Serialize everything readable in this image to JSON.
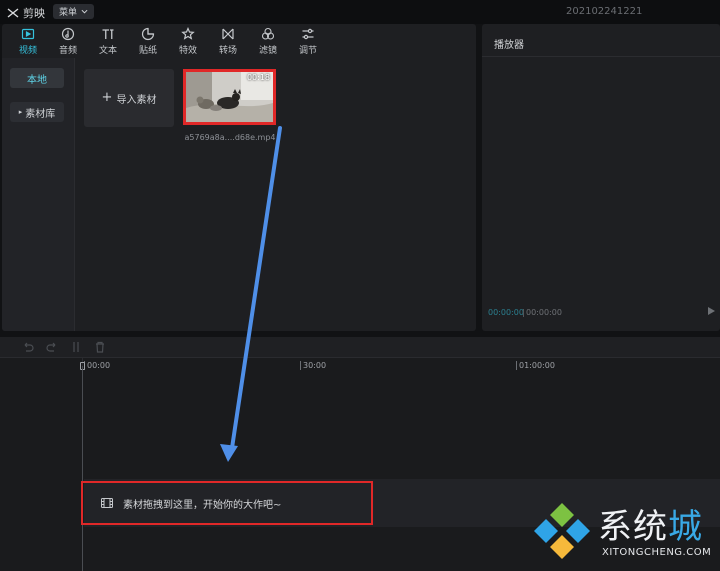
{
  "app": {
    "name": "剪映",
    "menu_label": "菜单",
    "window_title": "202102241221"
  },
  "toolbar": {
    "tabs": [
      {
        "label": "视频",
        "icon": "video-icon",
        "active": true
      },
      {
        "label": "音频",
        "icon": "audio-icon"
      },
      {
        "label": "文本",
        "icon": "text-icon"
      },
      {
        "label": "贴纸",
        "icon": "sticker-icon"
      },
      {
        "label": "特效",
        "icon": "effects-icon"
      },
      {
        "label": "转场",
        "icon": "transition-icon"
      },
      {
        "label": "滤镜",
        "icon": "filter-icon"
      },
      {
        "label": "调节",
        "icon": "adjust-icon"
      }
    ]
  },
  "sidebar": {
    "local": "本地",
    "library": "素材库"
  },
  "media": {
    "import_label": "导入素材",
    "items": [
      {
        "filename": "a5769a8a....d68e.mp4",
        "duration": "00:18"
      }
    ]
  },
  "player": {
    "title": "播放器",
    "current_time": "00:00:00",
    "separator": "|",
    "total_time": "00:00:00"
  },
  "timeline": {
    "ruler": [
      "00:00",
      "30:00",
      "01:00:00"
    ],
    "drop_hint": "素材拖拽到这里，开始你的大作吧~"
  },
  "watermark": {
    "name_part1": "系统",
    "name_part2": "城",
    "url": "XITONGCHENG.COM"
  },
  "colors": {
    "accent": "#35c2dd",
    "highlight_red": "#e02828",
    "arrow_blue": "#4f8fe8"
  }
}
